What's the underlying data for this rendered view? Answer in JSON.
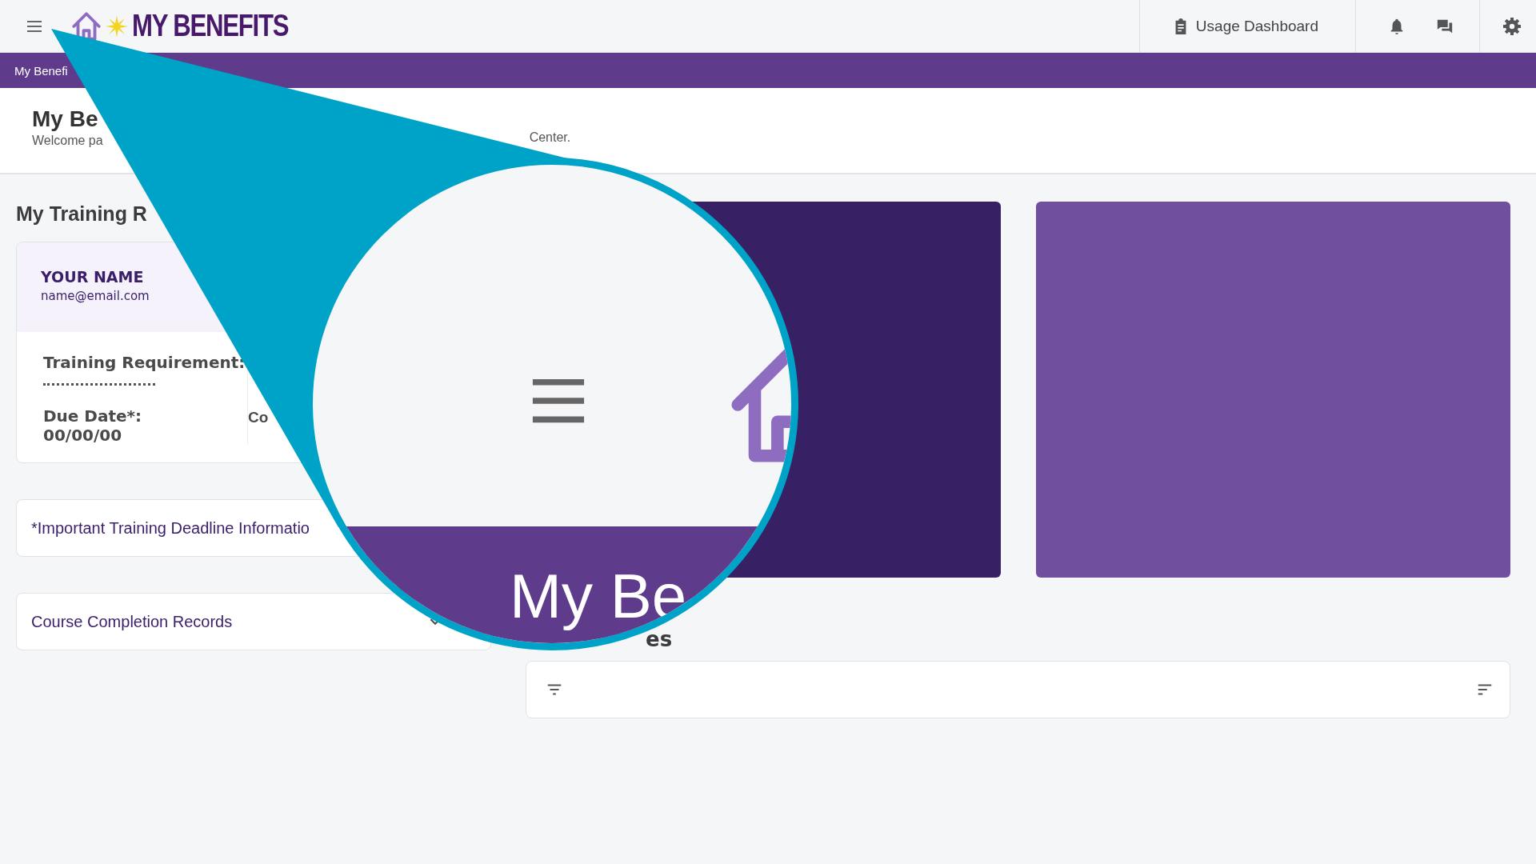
{
  "top_bar": {
    "logo_text": "MY BENEFITS",
    "usage_dashboard": "Usage Dashboard"
  },
  "breadcrumb": "My Benefi",
  "page_header": {
    "title": "My Be",
    "subtitle_start": "Welcome pa",
    "subtitle_end": "Center."
  },
  "training": {
    "heading": "My Training R",
    "name": "YOUR NAME",
    "email": "name@email.com",
    "requirement_label": "Training Requirement:",
    "due_label": "Due Date*:",
    "due_value": "00/00/00",
    "column_2_label": "Co"
  },
  "panels": [
    {
      "title": "*Important Training Deadline Informatio",
      "kind": "plain"
    },
    {
      "title": "Course Completion Records",
      "kind": "dropdown"
    }
  ],
  "section_heading": "es",
  "magnifier": {
    "caption": "My Be"
  }
}
